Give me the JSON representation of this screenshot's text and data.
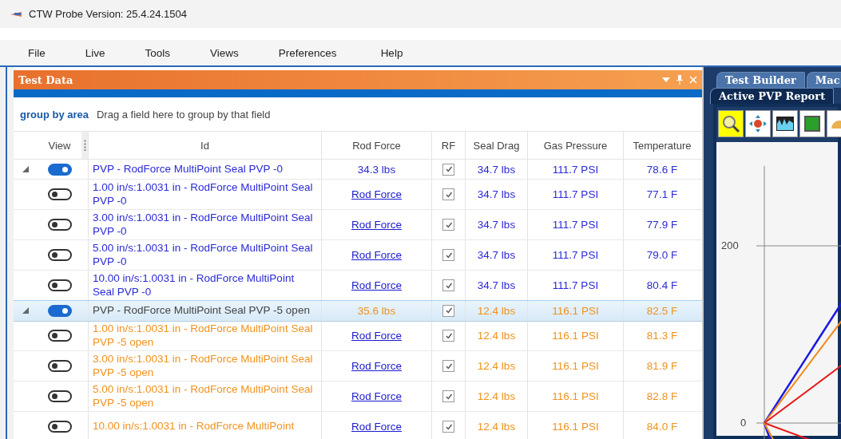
{
  "window": {
    "title": "CTW Probe Version: 25.4.24.1504"
  },
  "menu": [
    "File",
    "Live",
    "Tools",
    "Views",
    "Preferences",
    "Help"
  ],
  "test_data_panel": {
    "title": "Test Data",
    "group_by": {
      "label": "group by area",
      "hint": "Drag a field here to group by that field"
    },
    "table": {
      "columns": [
        "View",
        "Id",
        "Rod Force",
        "RF",
        "Seal Drag",
        "Gas Pressure",
        "Temperature"
      ],
      "rows": [
        {
          "kind": "group",
          "expanded": true,
          "on": true,
          "selected": false,
          "id": "PVP - RodForce MultiPoint Seal PVP -0",
          "rod_force": "34.3 lbs",
          "rf": true,
          "seal_drag": "34.7 lbs",
          "gas_pressure": "111.7 PSI",
          "temperature": "78.6 F",
          "color": "#2a2ad6"
        },
        {
          "kind": "child",
          "on": false,
          "selected": false,
          "id": "1.00 in/s:1.0031 in - RodForce MultiPoint Seal PVP -0",
          "rod_force": "Rod Force",
          "rf": true,
          "seal_drag": "34.7 lbs",
          "gas_pressure": "111.7 PSI",
          "temperature": "77.1 F",
          "color": "#2a2ad6"
        },
        {
          "kind": "child",
          "on": false,
          "selected": false,
          "id": "3.00 in/s:1.0031 in - RodForce MultiPoint Seal PVP -0",
          "rod_force": "Rod Force",
          "rf": true,
          "seal_drag": "34.7 lbs",
          "gas_pressure": "111.7 PSI",
          "temperature": "77.9 F",
          "color": "#2a2ad6"
        },
        {
          "kind": "child",
          "on": false,
          "selected": false,
          "id": "5.00 in/s:1.0031 in - RodForce MultiPoint Seal PVP -0",
          "rod_force": "Rod Force",
          "rf": true,
          "seal_drag": "34.7 lbs",
          "gas_pressure": "111.7 PSI",
          "temperature": "79.0 F",
          "color": "#2a2ad6"
        },
        {
          "kind": "child",
          "on": false,
          "selected": false,
          "id": "10.00 in/s:1.0031 in - RodForce MultiPoint Seal PVP -0",
          "rod_force": "Rod Force",
          "rf": true,
          "seal_drag": "34.7 lbs",
          "gas_pressure": "111.7 PSI",
          "temperature": "80.4 F",
          "color": "#2a2ad6"
        },
        {
          "kind": "group",
          "expanded": true,
          "on": true,
          "selected": true,
          "id": "PVP - RodForce MultiPoint Seal PVP -5 open",
          "rod_force": "35.6 lbs",
          "rf": true,
          "seal_drag": "12.4 lbs",
          "gas_pressure": "116.1 PSI",
          "temperature": "82.5 F",
          "color": "#f0921e"
        },
        {
          "kind": "child",
          "on": false,
          "selected": false,
          "id": "1.00 in/s:1.0031 in - RodForce MultiPoint Seal PVP -5 open",
          "rod_force": "Rod Force",
          "rf": true,
          "seal_drag": "12.4 lbs",
          "gas_pressure": "116.1 PSI",
          "temperature": "81.3 F",
          "color": "#f0921e"
        },
        {
          "kind": "child",
          "on": false,
          "selected": false,
          "id": "3.00 in/s:1.0031 in - RodForce MultiPoint Seal PVP -5 open",
          "rod_force": "Rod Force",
          "rf": true,
          "seal_drag": "12.4 lbs",
          "gas_pressure": "116.1 PSI",
          "temperature": "81.9 F",
          "color": "#f0921e"
        },
        {
          "kind": "child",
          "on": false,
          "selected": false,
          "id": "5.00 in/s:1.0031 in - RodForce MultiPoint Seal PVP -5 open",
          "rod_force": "Rod Force",
          "rf": true,
          "seal_drag": "12.4 lbs",
          "gas_pressure": "116.1 PSI",
          "temperature": "82.8 F",
          "color": "#f0921e"
        },
        {
          "kind": "child",
          "on": false,
          "selected": false,
          "id": "10.00 in/s:1.0031 in - RodForce MultiPoint",
          "rod_force": "Rod Force",
          "rf": true,
          "seal_drag": "12.4 lbs",
          "gas_pressure": "116.1 PSI",
          "temperature": "84.0 F",
          "color": "#f0921e"
        }
      ]
    }
  },
  "report_panel": {
    "tabs": [
      {
        "label": "Test Builder",
        "selected": false
      },
      {
        "label": "Mac",
        "selected": false
      },
      {
        "label": "Active PVP Report",
        "selected": true
      }
    ],
    "toolbar": [
      {
        "kind": "zoom",
        "selected": true
      },
      {
        "kind": "pan",
        "selected": false
      },
      {
        "kind": "wave",
        "selected": false
      },
      {
        "kind": "panel",
        "selected": false
      },
      {
        "kind": "gauge",
        "selected": false
      }
    ],
    "chart": {
      "y_labels": [
        "200",
        "0"
      ]
    }
  }
}
